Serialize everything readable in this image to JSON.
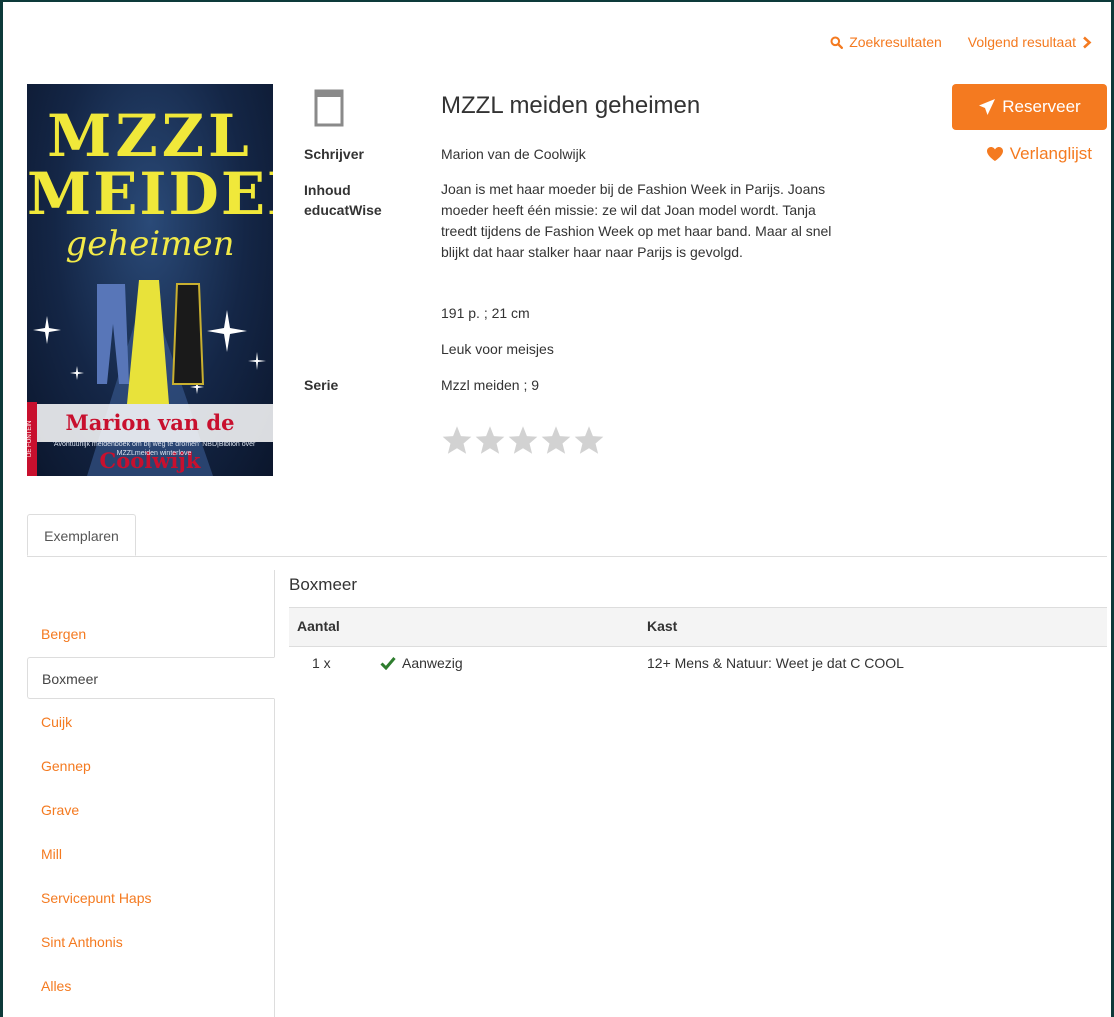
{
  "nav": {
    "search_results": "Zoekresultaten",
    "next_result": "Volgend resultaat"
  },
  "cover": {
    "line1": "MZZL",
    "line2": "MEIDEN",
    "line3": "geheimen",
    "author": "Marion van de Coolwijk",
    "quote": "'Avontuurlijk meidenboek om bij weg te dromen' NBD|Biblion over MZZLmeiden winterlove",
    "publisher": "DE FONTEIN"
  },
  "book": {
    "title": "MZZL meiden geheimen",
    "author_label": "Schrijver",
    "author": "Marion van de Coolwijk",
    "content_label_1": "Inhoud",
    "content_label_2": "educatWise",
    "description": "Joan is met haar moeder bij de Fashion Week in Parijs. Joans moeder heeft één missie: ze wil dat Joan model wordt. Tanja treedt tijdens de Fashion Week op met haar band. Maar al snel blijkt dat haar stalker haar naar Parijs is gevolgd.",
    "extent": "191 p. ; 21 cm",
    "note": "Leuk voor meisjes",
    "series_label": "Serie",
    "series": "Mzzl meiden ; 9",
    "rating": 0,
    "rating_max": 5
  },
  "actions": {
    "reserve": "Reserveer",
    "wishlist": "Verlanglijst"
  },
  "tabs": {
    "copies": "Exemplaren"
  },
  "branches": [
    {
      "label": "Bergen"
    },
    {
      "label": "Boxmeer",
      "active": true
    },
    {
      "label": "Cuijk"
    },
    {
      "label": "Gennep"
    },
    {
      "label": "Grave"
    },
    {
      "label": "Mill"
    },
    {
      "label": "Servicepunt Haps"
    },
    {
      "label": "Sint Anthonis"
    },
    {
      "label": "Alles"
    }
  ],
  "holdings": {
    "branch": "Boxmeer",
    "col_count": "Aantal",
    "col_shelf": "Kast",
    "rows": [
      {
        "count": "1 x",
        "status": "Aanwezig",
        "shelf": "12+ Mens & Natuur: Weet je dat C COOL"
      }
    ]
  },
  "colors": {
    "accent": "#f47a20",
    "available": "#2e7d2e"
  }
}
